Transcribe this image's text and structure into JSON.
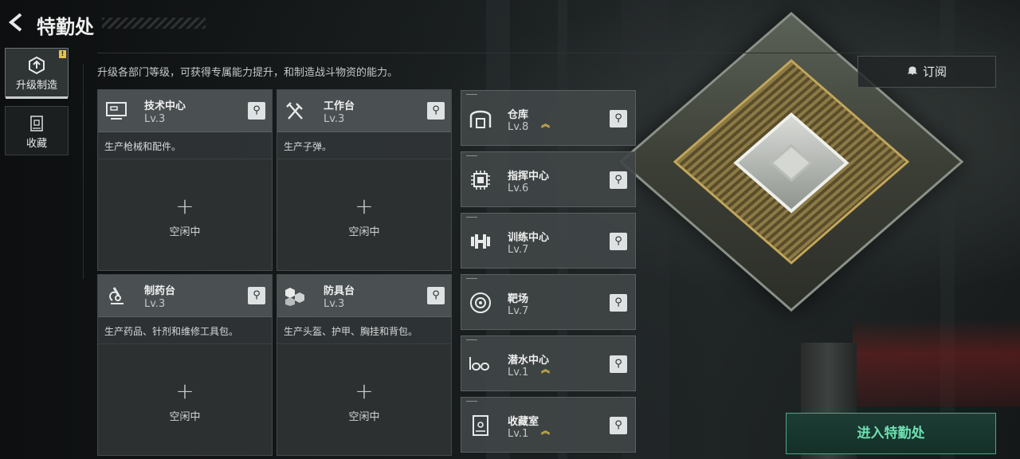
{
  "header": {
    "title": "特勤处",
    "back_icon": "back-arrow-icon"
  },
  "sidebar": {
    "tabs": [
      {
        "label": "升级制造",
        "icon": "upgrade-icon",
        "active": true,
        "badge": "!"
      },
      {
        "label": "收藏",
        "icon": "collection-icon",
        "active": false
      }
    ]
  },
  "description": "升级各部门等级，可获得专属能力提升，和制造战斗物资的能力。",
  "workshops": [
    {
      "name": "技术中心",
      "level": "Lv.3",
      "desc": "生产枪械和配件。",
      "status": "空闲中",
      "icon": "computer-icon"
    },
    {
      "name": "工作台",
      "level": "Lv.3",
      "desc": "生产子弹。",
      "status": "空闲中",
      "icon": "tools-icon"
    },
    {
      "name": "制药台",
      "level": "Lv.3",
      "desc": "生产药品、针剂和维修工具包。",
      "status": "空闲中",
      "icon": "microscope-icon"
    },
    {
      "name": "防具台",
      "level": "Lv.3",
      "desc": "生产头盔、护甲、胸挂和背包。",
      "status": "空闲中",
      "icon": "armor-icon"
    }
  ],
  "facilities": [
    {
      "name": "仓库",
      "level": "Lv.8",
      "upgradable": true,
      "icon": "warehouse-icon"
    },
    {
      "name": "指挥中心",
      "level": "Lv.6",
      "upgradable": false,
      "icon": "chip-icon"
    },
    {
      "name": "训练中心",
      "level": "Lv.7",
      "upgradable": false,
      "icon": "dumbbell-icon"
    },
    {
      "name": "靶场",
      "level": "Lv.7",
      "upgradable": false,
      "icon": "target-icon"
    },
    {
      "name": "潜水中心",
      "level": "Lv.1",
      "upgradable": true,
      "icon": "diving-goggles-icon"
    },
    {
      "name": "收藏室",
      "level": "Lv.1",
      "upgradable": true,
      "icon": "display-case-icon"
    }
  ],
  "upgrade_glyph": "︽",
  "search_glyph": "⚲",
  "plus_glyph": "+",
  "buttons": {
    "subscribe": "订阅",
    "enter": "进入特勤处"
  },
  "colors": {
    "accent_green": "#6fe0b3",
    "upgrade_gold": "#e2c04a",
    "badge_yellow": "#e6c34a"
  }
}
